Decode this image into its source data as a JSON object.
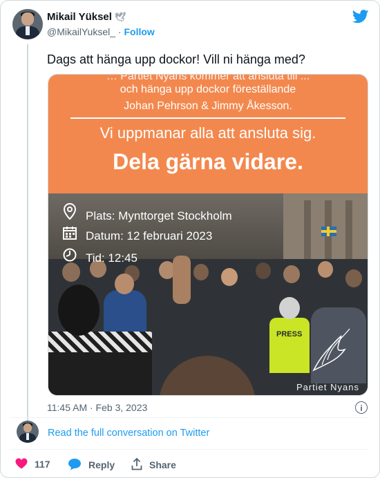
{
  "author": {
    "name": "Mikail Yüksel",
    "handle": "@MikailYuksel_",
    "separator": "·",
    "follow_label": "Follow"
  },
  "tweet": {
    "text": "Dags att hänga upp dockor! Vill ni hänga med?",
    "timestamp": "11:45 AM · Feb 3, 2023"
  },
  "media": {
    "banner_line0": "… Partiet Nyans kommer att ansluta till ...",
    "banner_line1": "och hänga upp dockor föreställande",
    "banner_line2": "Johan Pehrson & Jimmy Åkesson.",
    "banner_line3": "Vi uppmanar alla att ansluta sig.",
    "banner_line4": "Dela gärna vidare.",
    "place": "Plats: Mynttorget Stockholm",
    "date": "Datum: 12 februari 2023",
    "time": "Tid: 12:45",
    "watermark": "Partiet Nyans",
    "vest_text": "PRESS"
  },
  "footer": {
    "read_conversation": "Read the full conversation on Twitter",
    "like_count": "117",
    "reply_label": "Reply",
    "share_label": "Share"
  },
  "colors": {
    "accent": "#1d9bf0",
    "banner": "#f3884e",
    "like": "#f91880"
  }
}
